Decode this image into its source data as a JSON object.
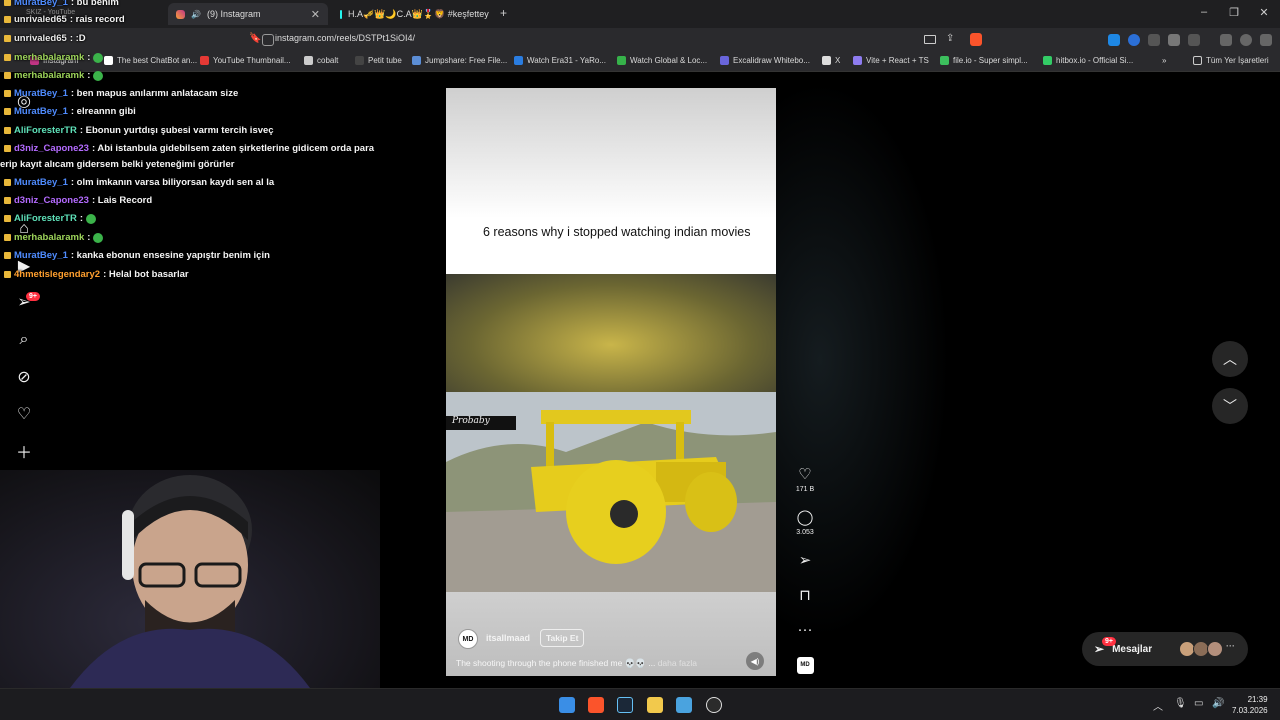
{
  "browser": {
    "tabs": [
      {
        "title": "(9) Instagram",
        "icon": "instagram-icon"
      },
      {
        "title": "H.A🎺👑🌙C.A👑🎖️🦁 #keşfettey",
        "icon": "tiktok-icon"
      }
    ],
    "faded_tab": "SKIZ - YouTube",
    "new_tab_label": "+",
    "url": "instagram.com/reels/DSTPt1SiOI4/",
    "bookmarks": [
      {
        "label": "Instagram",
        "color": "#c13584"
      },
      {
        "label": "The best ChatBot an...",
        "color": "#ffffff"
      },
      {
        "label": "YouTube Thumbnail...",
        "color": "#e53935"
      },
      {
        "label": "cobalt",
        "color": "#cccccc"
      },
      {
        "label": "Petit tube",
        "color": "#444444"
      },
      {
        "label": "Jumpshare: Free File...",
        "color": "#5c8ed6"
      },
      {
        "label": "Watch Era31 - YaRo...",
        "color": "#2a7de1"
      },
      {
        "label": "Watch Global & Loc...",
        "color": "#36b24a"
      },
      {
        "label": "Excalidraw Whitebo...",
        "color": "#6965db"
      },
      {
        "label": "X",
        "color": "#dddddd"
      },
      {
        "label": "Vite + React + TS",
        "color": "#8e7cf0"
      },
      {
        "label": "file.io - Super simpl...",
        "color": "#3cbf5d"
      },
      {
        "label": "hitbox.io - Official Si...",
        "color": "#33cc66"
      }
    ],
    "bookmarks_more": "»",
    "all_bookmarks": "Tüm Yer İşaretleri"
  },
  "chat": {
    "messages": [
      {
        "user": "MuratBey_1",
        "text": " : bu benim",
        "color": "#4f8cff"
      },
      {
        "user": "unrivaled65",
        "text": " : rais record",
        "color": "#e8e8e8"
      },
      {
        "user": "unrivaled65",
        "text": " : :D",
        "color": "#e8e8e8"
      },
      {
        "user": "merhabalaramk",
        "text": " : ",
        "color": "#9dd45a"
      },
      {
        "user": "merhabalaramk",
        "text": " : ",
        "color": "#9dd45a"
      },
      {
        "user": "MuratBey_1",
        "text": " : ben mapus anılarımı anlatacam size",
        "color": "#4f8cff"
      },
      {
        "user": "MuratBey_1",
        "text": " : elreannn gibi",
        "color": "#4f8cff"
      },
      {
        "user": "AliForesterTR",
        "text": " : Ebonun yurtdışı şubesi varmı tercih isveç",
        "color": "#5ee0b8"
      },
      {
        "user": "d3niz_Capone23",
        "text": " : Abi istanbula gidebilsem zaten şirketlerine gidicem orda para",
        "color": "#b46bff"
      },
      {
        "user": "",
        "text": "erip kayıt alıcam gidersem belki yeteneğimi görürler",
        "color": "#ffffff"
      },
      {
        "user": "MuratBey_1",
        "text": " : olm imkanın varsa biliyorsan kaydı sen al la",
        "color": "#4f8cff"
      },
      {
        "user": "d3niz_Capone23",
        "text": " : Lais Record",
        "color": "#b46bff"
      },
      {
        "user": "AliForesterTR",
        "text": " : ",
        "color": "#5ee0b8"
      },
      {
        "user": "merhabalaramk",
        "text": " : ",
        "color": "#9dd45a"
      },
      {
        "user": "MuratBey_1",
        "text": " : kanka ebonun ensesine yapıştır benim için",
        "color": "#4f8cff"
      },
      {
        "user": "4hmetislegendary2",
        "text": " : Helal bot basarlar",
        "color": "#ff9f2e"
      }
    ]
  },
  "instagram": {
    "nav_badge": "9+",
    "reel": {
      "title": "6 reasons why i stopped watching indian movies",
      "watermark": "Probaby",
      "username": "itsallmaad",
      "avatar_text": "MD",
      "follow_label": "Takip Et",
      "caption": "The shooting through the phone finished me 💀💀 ...",
      "caption_more": "daha fazla"
    },
    "actions": {
      "likes": "171 B",
      "comments": "3.053"
    },
    "messages_label": "Mesajlar",
    "messages_badge": "9+"
  },
  "taskbar": {
    "time": "21:39",
    "date": "7.03.2026"
  }
}
